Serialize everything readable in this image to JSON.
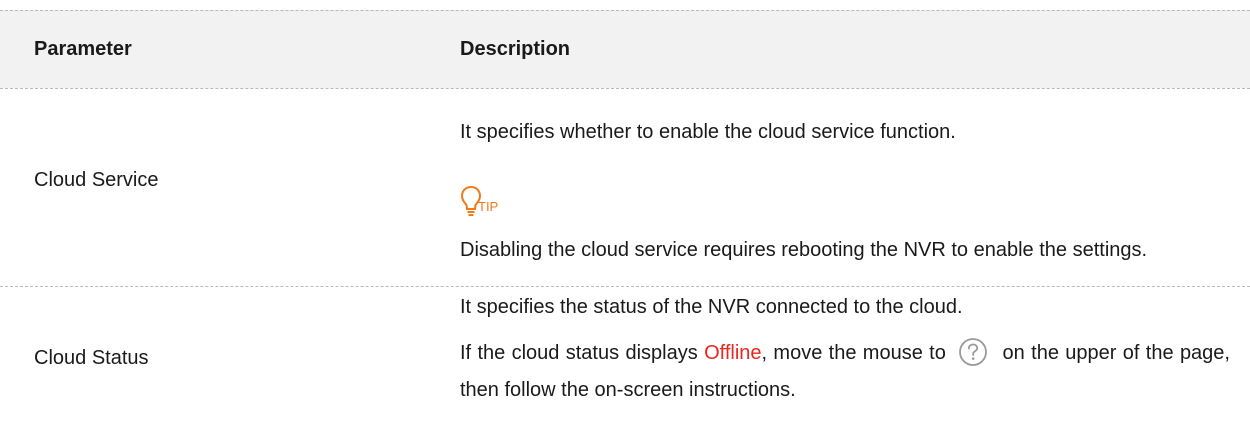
{
  "header": {
    "parameter": "Parameter",
    "description": "Description"
  },
  "rows": [
    {
      "parameter": "Cloud Service",
      "line1": "It specifies whether to enable the cloud service function.",
      "tip_label": "TIP",
      "line2": "Disabling the cloud service requires rebooting the NVR to enable the settings."
    },
    {
      "parameter": "Cloud Status",
      "line1": "It specifies the status of the NVR connected to the cloud.",
      "line2_a": "If the cloud status displays ",
      "line2_status": "Offline",
      "line2_b": ", move the mouse to ",
      "line2_c": " on the upper of the page, then follow the on-screen instructions."
    }
  ],
  "colors": {
    "status_offline": "#e8281f",
    "tip_accent": "#f07a1a",
    "header_bg": "#f2f2f2"
  },
  "icons": [
    "lightbulb-icon",
    "question-circle-icon"
  ]
}
